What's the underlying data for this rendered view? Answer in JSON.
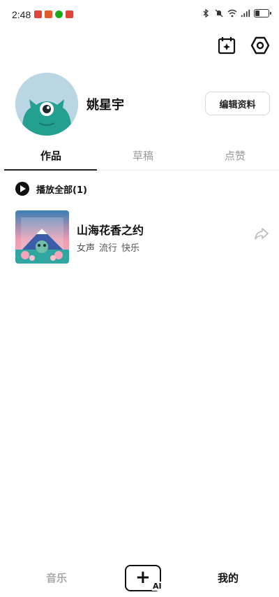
{
  "status_bar": {
    "time": "2:48",
    "notifications": [
      {
        "icon": "app-red-icon",
        "color": "#e0443a"
      },
      {
        "icon": "app-orange-icon",
        "color": "#e65b2c"
      },
      {
        "icon": "wechat-icon",
        "color": "#1aad19"
      },
      {
        "icon": "app-red-square-icon",
        "color": "#e0443a"
      }
    ],
    "battery_level": 0.3
  },
  "header_icons": [
    "calendar-add-icon",
    "settings-icon"
  ],
  "profile": {
    "username": "姚星宇",
    "edit_button": "编辑资料"
  },
  "tabs": [
    {
      "label": "作品",
      "active": true
    },
    {
      "label": "草稿",
      "active": false
    },
    {
      "label": "点赞",
      "active": false
    }
  ],
  "play_all": {
    "label": "播放全部(1)"
  },
  "songs": [
    {
      "title": "山海花香之约",
      "tags": [
        "女声",
        "流行",
        "快乐"
      ]
    }
  ],
  "bottom_nav": {
    "music": "音乐",
    "create_ai": "AI",
    "mine": "我的"
  },
  "colors": {
    "accent": "#111111",
    "inactive": "#999999"
  }
}
